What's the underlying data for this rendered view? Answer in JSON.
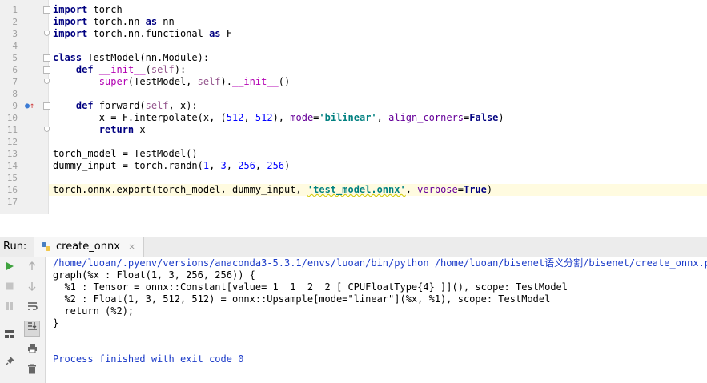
{
  "editor": {
    "line_numbers": [
      "1",
      "2",
      "3",
      "4",
      "5",
      "6",
      "7",
      "8",
      "9",
      "10",
      "11",
      "12",
      "13",
      "14",
      "15",
      "16",
      "17"
    ],
    "current_line": 16,
    "lines": [
      [
        {
          "t": "import",
          "c": "kw"
        },
        {
          "t": " torch"
        }
      ],
      [
        {
          "t": "import",
          "c": "kw"
        },
        {
          "t": " torch.nn "
        },
        {
          "t": "as",
          "c": "kw"
        },
        {
          "t": " nn"
        }
      ],
      [
        {
          "t": "import",
          "c": "kw"
        },
        {
          "t": " torch.nn.functional "
        },
        {
          "t": "as",
          "c": "kw"
        },
        {
          "t": " F"
        }
      ],
      [],
      [
        {
          "t": "class",
          "c": "kw"
        },
        {
          "t": " TestModel(nn.Module):"
        }
      ],
      [
        {
          "t": "    "
        },
        {
          "t": "def",
          "c": "kw"
        },
        {
          "t": " "
        },
        {
          "t": "__init__",
          "c": "mag"
        },
        {
          "t": "("
        },
        {
          "t": "self",
          "c": "self"
        },
        {
          "t": "):"
        }
      ],
      [
        {
          "t": "        "
        },
        {
          "t": "super",
          "c": "mag"
        },
        {
          "t": "(TestModel, "
        },
        {
          "t": "self",
          "c": "self"
        },
        {
          "t": ")."
        },
        {
          "t": "__init__",
          "c": "mag"
        },
        {
          "t": "()"
        }
      ],
      [],
      [
        {
          "t": "    "
        },
        {
          "t": "def",
          "c": "kw"
        },
        {
          "t": " forward("
        },
        {
          "t": "self",
          "c": "self"
        },
        {
          "t": ", x):"
        }
      ],
      [
        {
          "t": "        x = F.interpolate(x, ("
        },
        {
          "t": "512",
          "c": "num"
        },
        {
          "t": ", "
        },
        {
          "t": "512",
          "c": "num"
        },
        {
          "t": "), "
        },
        {
          "t": "mode",
          "c": "kwarg"
        },
        {
          "t": "="
        },
        {
          "t": "'bilinear'",
          "c": "str"
        },
        {
          "t": ", "
        },
        {
          "t": "align_corners",
          "c": "kwarg"
        },
        {
          "t": "="
        },
        {
          "t": "False",
          "c": "bool"
        },
        {
          "t": ")"
        }
      ],
      [
        {
          "t": "        "
        },
        {
          "t": "return",
          "c": "kw"
        },
        {
          "t": " x"
        }
      ],
      [],
      [
        {
          "t": "torch_model = TestModel()"
        }
      ],
      [
        {
          "t": "dummy_input = torch.randn("
        },
        {
          "t": "1",
          "c": "num"
        },
        {
          "t": ", "
        },
        {
          "t": "3",
          "c": "num"
        },
        {
          "t": ", "
        },
        {
          "t": "256",
          "c": "num"
        },
        {
          "t": ", "
        },
        {
          "t": "256",
          "c": "num"
        },
        {
          "t": ")"
        }
      ],
      [],
      [
        {
          "t": "torch.onnx.export(torch_model, dummy_input, "
        },
        {
          "t": "'test_model.onnx'",
          "c": "str squig"
        },
        {
          "t": ", "
        },
        {
          "t": "verbose",
          "c": "kwarg"
        },
        {
          "t": "="
        },
        {
          "t": "True",
          "c": "bool"
        },
        {
          "t": ")"
        }
      ],
      []
    ]
  },
  "run_panel": {
    "label": "Run:",
    "tab_label": "create_onnx",
    "tab_close": "×",
    "output": [
      {
        "t": "/home/luoan/.pyenv/versions/anaconda3-5.3.1/envs/luoan/bin/python /home/luoan/bisenet语义分割/bisenet/create_onnx.py",
        "c": "link"
      },
      {
        "t": "graph(%x : Float(1, 3, 256, 256)) {"
      },
      {
        "t": "  %1 : Tensor = onnx::Constant[value= 1  1  2  2 [ CPUFloatType{4} ]](), scope: TestModel"
      },
      {
        "t": "  %2 : Float(1, 3, 512, 512) = onnx::Upsample[mode=\"linear\"](%x, %1), scope: TestModel"
      },
      {
        "t": "  return (%2);"
      },
      {
        "t": "}"
      },
      {
        "t": ""
      },
      {
        "t": ""
      },
      {
        "t": "Process finished with exit code 0",
        "c": "exit"
      }
    ]
  },
  "colors": {
    "accent": "#1a3ac8",
    "run_green": "#3fa33f",
    "current_line": "#fffbe0"
  }
}
